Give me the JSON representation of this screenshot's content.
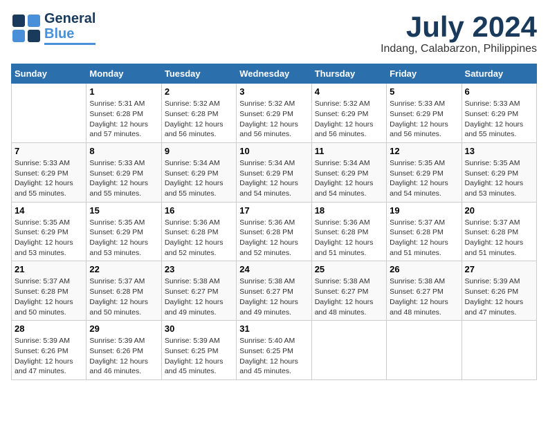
{
  "header": {
    "logo_line1": "General",
    "logo_line2": "Blue",
    "title": "July 2024",
    "subtitle": "Indang, Calabarzon, Philippines"
  },
  "days_of_week": [
    "Sunday",
    "Monday",
    "Tuesday",
    "Wednesday",
    "Thursday",
    "Friday",
    "Saturday"
  ],
  "weeks": [
    [
      {
        "day": "",
        "info": ""
      },
      {
        "day": "1",
        "info": "Sunrise: 5:31 AM\nSunset: 6:28 PM\nDaylight: 12 hours\nand 57 minutes."
      },
      {
        "day": "2",
        "info": "Sunrise: 5:32 AM\nSunset: 6:28 PM\nDaylight: 12 hours\nand 56 minutes."
      },
      {
        "day": "3",
        "info": "Sunrise: 5:32 AM\nSunset: 6:29 PM\nDaylight: 12 hours\nand 56 minutes."
      },
      {
        "day": "4",
        "info": "Sunrise: 5:32 AM\nSunset: 6:29 PM\nDaylight: 12 hours\nand 56 minutes."
      },
      {
        "day": "5",
        "info": "Sunrise: 5:33 AM\nSunset: 6:29 PM\nDaylight: 12 hours\nand 56 minutes."
      },
      {
        "day": "6",
        "info": "Sunrise: 5:33 AM\nSunset: 6:29 PM\nDaylight: 12 hours\nand 55 minutes."
      }
    ],
    [
      {
        "day": "7",
        "info": "Sunrise: 5:33 AM\nSunset: 6:29 PM\nDaylight: 12 hours\nand 55 minutes."
      },
      {
        "day": "8",
        "info": "Sunrise: 5:33 AM\nSunset: 6:29 PM\nDaylight: 12 hours\nand 55 minutes."
      },
      {
        "day": "9",
        "info": "Sunrise: 5:34 AM\nSunset: 6:29 PM\nDaylight: 12 hours\nand 55 minutes."
      },
      {
        "day": "10",
        "info": "Sunrise: 5:34 AM\nSunset: 6:29 PM\nDaylight: 12 hours\nand 54 minutes."
      },
      {
        "day": "11",
        "info": "Sunrise: 5:34 AM\nSunset: 6:29 PM\nDaylight: 12 hours\nand 54 minutes."
      },
      {
        "day": "12",
        "info": "Sunrise: 5:35 AM\nSunset: 6:29 PM\nDaylight: 12 hours\nand 54 minutes."
      },
      {
        "day": "13",
        "info": "Sunrise: 5:35 AM\nSunset: 6:29 PM\nDaylight: 12 hours\nand 53 minutes."
      }
    ],
    [
      {
        "day": "14",
        "info": "Sunrise: 5:35 AM\nSunset: 6:29 PM\nDaylight: 12 hours\nand 53 minutes."
      },
      {
        "day": "15",
        "info": "Sunrise: 5:35 AM\nSunset: 6:29 PM\nDaylight: 12 hours\nand 53 minutes."
      },
      {
        "day": "16",
        "info": "Sunrise: 5:36 AM\nSunset: 6:28 PM\nDaylight: 12 hours\nand 52 minutes."
      },
      {
        "day": "17",
        "info": "Sunrise: 5:36 AM\nSunset: 6:28 PM\nDaylight: 12 hours\nand 52 minutes."
      },
      {
        "day": "18",
        "info": "Sunrise: 5:36 AM\nSunset: 6:28 PM\nDaylight: 12 hours\nand 51 minutes."
      },
      {
        "day": "19",
        "info": "Sunrise: 5:37 AM\nSunset: 6:28 PM\nDaylight: 12 hours\nand 51 minutes."
      },
      {
        "day": "20",
        "info": "Sunrise: 5:37 AM\nSunset: 6:28 PM\nDaylight: 12 hours\nand 51 minutes."
      }
    ],
    [
      {
        "day": "21",
        "info": "Sunrise: 5:37 AM\nSunset: 6:28 PM\nDaylight: 12 hours\nand 50 minutes."
      },
      {
        "day": "22",
        "info": "Sunrise: 5:37 AM\nSunset: 6:28 PM\nDaylight: 12 hours\nand 50 minutes."
      },
      {
        "day": "23",
        "info": "Sunrise: 5:38 AM\nSunset: 6:27 PM\nDaylight: 12 hours\nand 49 minutes."
      },
      {
        "day": "24",
        "info": "Sunrise: 5:38 AM\nSunset: 6:27 PM\nDaylight: 12 hours\nand 49 minutes."
      },
      {
        "day": "25",
        "info": "Sunrise: 5:38 AM\nSunset: 6:27 PM\nDaylight: 12 hours\nand 48 minutes."
      },
      {
        "day": "26",
        "info": "Sunrise: 5:38 AM\nSunset: 6:27 PM\nDaylight: 12 hours\nand 48 minutes."
      },
      {
        "day": "27",
        "info": "Sunrise: 5:39 AM\nSunset: 6:26 PM\nDaylight: 12 hours\nand 47 minutes."
      }
    ],
    [
      {
        "day": "28",
        "info": "Sunrise: 5:39 AM\nSunset: 6:26 PM\nDaylight: 12 hours\nand 47 minutes."
      },
      {
        "day": "29",
        "info": "Sunrise: 5:39 AM\nSunset: 6:26 PM\nDaylight: 12 hours\nand 46 minutes."
      },
      {
        "day": "30",
        "info": "Sunrise: 5:39 AM\nSunset: 6:25 PM\nDaylight: 12 hours\nand 45 minutes."
      },
      {
        "day": "31",
        "info": "Sunrise: 5:40 AM\nSunset: 6:25 PM\nDaylight: 12 hours\nand 45 minutes."
      },
      {
        "day": "",
        "info": ""
      },
      {
        "day": "",
        "info": ""
      },
      {
        "day": "",
        "info": ""
      }
    ]
  ]
}
